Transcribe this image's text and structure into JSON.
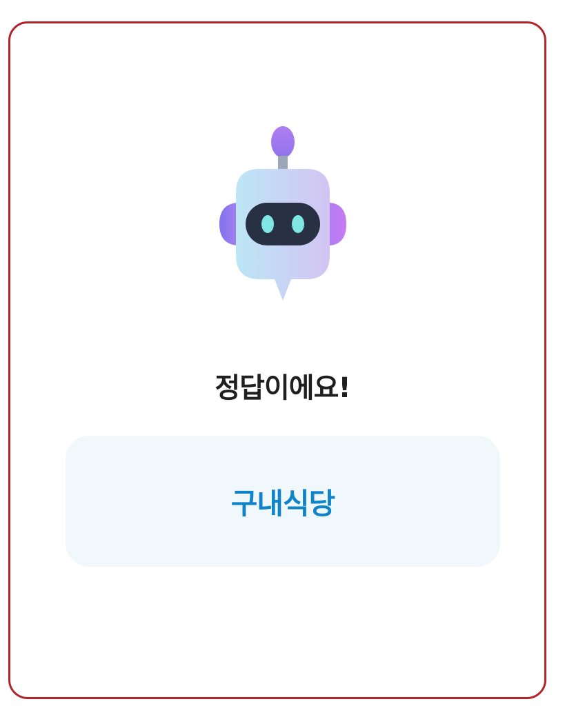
{
  "result": {
    "title": "정답이에요!",
    "answer": "구내식당"
  },
  "icons": {
    "mascot": "robot-chat-icon"
  },
  "colors": {
    "frame_border": "#b0242c",
    "answer_background": "#f1f8fc",
    "answer_text": "#1184c9",
    "title_text": "#1f1f1f"
  }
}
